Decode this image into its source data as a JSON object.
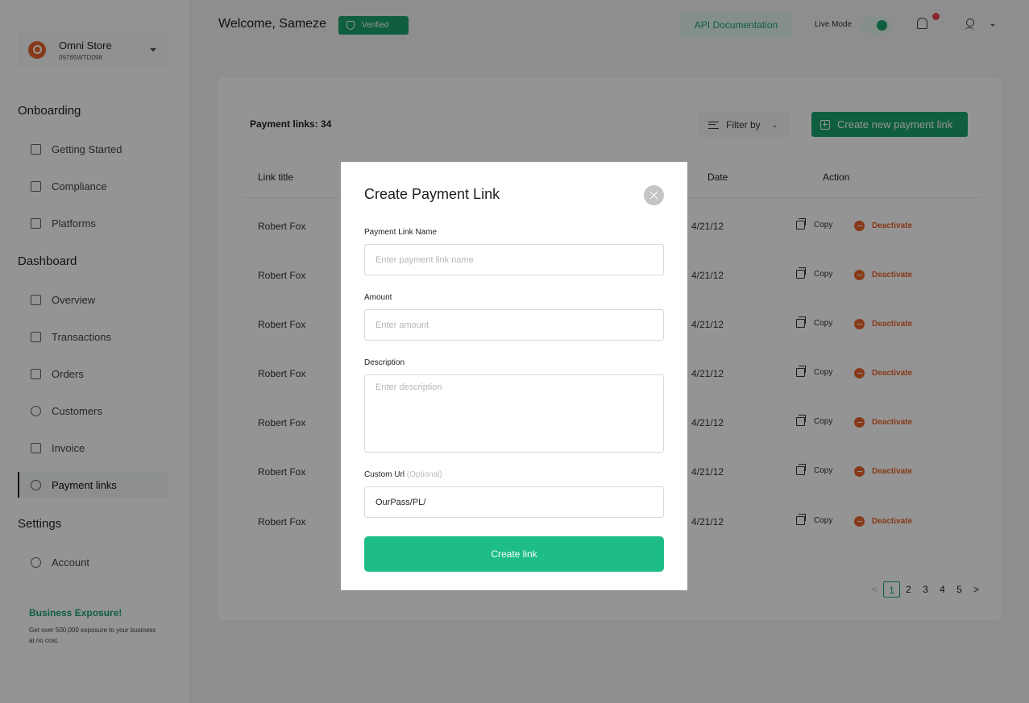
{
  "store": {
    "name": "Omni Store",
    "id": "09765WTD098"
  },
  "sidebar": {
    "onboarding_title": "Onboarding",
    "onboarding": [
      {
        "label": "Getting Started",
        "icon": "cup-icon"
      },
      {
        "label": "Compliance",
        "icon": "shield-icon"
      },
      {
        "label": "Platforms",
        "icon": "window-icon"
      }
    ],
    "dashboard_title": "Dashboard",
    "dashboard": [
      {
        "label": "Overview",
        "icon": "grid-icon"
      },
      {
        "label": "Transactions",
        "icon": "wallet-icon"
      },
      {
        "label": "Orders",
        "icon": "box-icon"
      },
      {
        "label": "Customers",
        "icon": "users-icon"
      },
      {
        "label": "Invoice",
        "icon": "invoice-icon"
      },
      {
        "label": "Payment links",
        "icon": "link-icon",
        "active": true
      }
    ],
    "settings_title": "Settings",
    "settings": [
      {
        "label": "Account",
        "icon": "account-icon"
      }
    ],
    "promo": {
      "title": "Business Exposure!",
      "text": "Get over 500,000 exposure to your business at no cost."
    }
  },
  "header": {
    "welcome": "Welcome, Sameze",
    "verified": "Verified",
    "api_docs": "API Documentation",
    "live_mode": "Live Mode",
    "live_mode_on": true
  },
  "main": {
    "count_label": "Payment links: 34",
    "filter_label": "Filter by",
    "create_label": "Create new payment link",
    "columns": {
      "title": "Link title",
      "date": "Date",
      "action": "Action"
    },
    "rows": [
      {
        "title": "Robert Fox",
        "date": "4/21/12",
        "copy": "Copy",
        "deactivate": "Deactivate"
      },
      {
        "title": "Robert Fox",
        "date": "4/21/12",
        "copy": "Copy",
        "deactivate": "Deactivate"
      },
      {
        "title": "Robert Fox",
        "date": "4/21/12",
        "copy": "Copy",
        "deactivate": "Deactivate"
      },
      {
        "title": "Robert Fox",
        "date": "4/21/12",
        "copy": "Copy",
        "deactivate": "Deactivate"
      },
      {
        "title": "Robert Fox",
        "date": "4/21/12",
        "copy": "Copy",
        "deactivate": "Deactivate"
      },
      {
        "title": "Robert Fox",
        "date": "4/21/12",
        "copy": "Copy",
        "deactivate": "Deactivate"
      },
      {
        "title": "Robert Fox",
        "date": "4/21/12",
        "copy": "Copy",
        "deactivate": "Deactivate"
      }
    ],
    "pagination": {
      "prev": "<",
      "pages": [
        "1",
        "2",
        "3",
        "4",
        "5"
      ],
      "current": "1",
      "next": ">"
    }
  },
  "modal": {
    "title": "Create Payment Link",
    "name_label": "Payment Link Name",
    "name_placeholder": "Enter payment link name",
    "amount_label": "Amount",
    "amount_placeholder": "Enter amount",
    "description_label": "Description",
    "description_placeholder": "Enter description",
    "url_label": "Custom Url",
    "url_optional": "(Optional)",
    "url_value": "OurPass/PL/",
    "submit_label": "Create link"
  },
  "colors": {
    "brand": "#1aa36f",
    "button": "#1dbd85",
    "danger": "#e8642c",
    "notification": "#e8425a"
  }
}
